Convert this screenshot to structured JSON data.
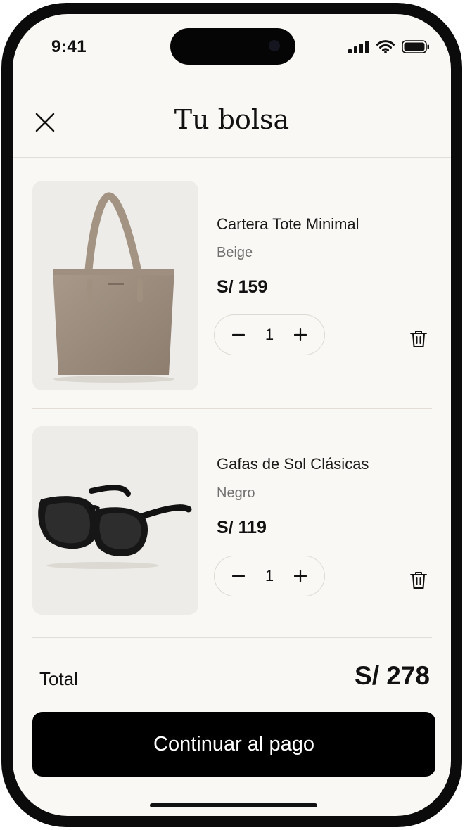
{
  "status_bar": {
    "time": "9:41"
  },
  "header": {
    "title": "Tu bolsa"
  },
  "cart": {
    "items": [
      {
        "name": "Cartera Tote Minimal",
        "variant": "Beige",
        "price": "S/ 159",
        "quantity": "1",
        "image": "tote-bag-image"
      },
      {
        "name": "Gafas de Sol Clásicas",
        "variant": "Negro",
        "price": "S/ 119",
        "quantity": "1",
        "image": "sunglasses-image"
      }
    ],
    "total_label": "Total",
    "total_value": "S/ 278",
    "checkout_label": "Continuar al pago"
  },
  "colors": {
    "background": "#faf8f4",
    "accent": "#000000",
    "divider": "#e2ded7",
    "muted_text": "#707070"
  },
  "icons": [
    "close-icon",
    "minus-icon",
    "plus-icon",
    "trash-icon",
    "signal-icon",
    "wifi-icon",
    "battery-icon"
  ]
}
